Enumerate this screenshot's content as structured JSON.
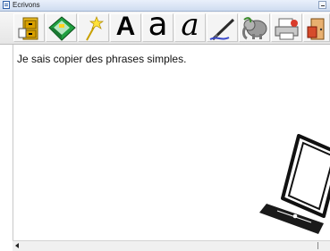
{
  "window": {
    "title": "Ecrivons"
  },
  "toolbar": {
    "buttons": [
      {
        "name": "cabinet",
        "label": ""
      },
      {
        "name": "diskette",
        "label": ""
      },
      {
        "name": "wand",
        "label": ""
      },
      {
        "name": "font-a-bold",
        "label": "A"
      },
      {
        "name": "font-a-round",
        "label": "a"
      },
      {
        "name": "font-a-cursive",
        "label": "a"
      },
      {
        "name": "pen",
        "label": ""
      },
      {
        "name": "elephant",
        "label": ""
      },
      {
        "name": "printer",
        "label": ""
      },
      {
        "name": "exit-door",
        "label": ""
      }
    ]
  },
  "document": {
    "text": "Je sais copier des phrases simples."
  },
  "colors": {
    "accent": "#2e5fa8",
    "background": "#ffffff"
  }
}
